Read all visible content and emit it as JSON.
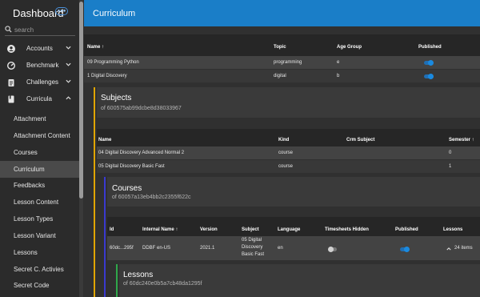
{
  "sidebar": {
    "title": "Dashboard",
    "badge": "●●●",
    "search_placeholder": "search",
    "sections": [
      {
        "label": "Accounts",
        "icon": "account-circle-icon"
      },
      {
        "label": "Benchmark",
        "icon": "speedometer-icon"
      },
      {
        "label": "Challenges",
        "icon": "clipboard-icon"
      },
      {
        "label": "Curricula",
        "icon": "book-icon"
      }
    ],
    "sub_items": [
      "Attachment",
      "Attachment Content",
      "Courses",
      "Curriculum",
      "Feedbacks",
      "Lesson Content",
      "Lesson Types",
      "Lesson Variant",
      "Lessons",
      "Secret C. Activies",
      "Secret Code"
    ],
    "active_item": "Curriculum"
  },
  "header": {
    "title": "Curriculum"
  },
  "curriculum_table": {
    "columns": [
      "Name ↑",
      "Topic",
      "Age Group",
      "Published"
    ],
    "rows": [
      {
        "name": "09 Programming Python",
        "topic": "programming",
        "age_group": "e",
        "published": true
      },
      {
        "name": "1 Digital Discovery",
        "topic": "digital",
        "age_group": "b",
        "published": true
      }
    ]
  },
  "subjects": {
    "title": "Subjects",
    "subtitle": "of 600575ab99dcbe8d38033967",
    "columns": [
      "Name",
      "Kind",
      "Crm Subject",
      "Semester ↑"
    ],
    "rows": [
      {
        "name": "04 Digital Discovery Advanced Normal 2",
        "kind": "course",
        "crm_subject": "",
        "semester": "0"
      },
      {
        "name": "05 Digital Discovery Basic Fast",
        "kind": "course",
        "crm_subject": "",
        "semester": "1"
      }
    ]
  },
  "courses": {
    "title": "Courses",
    "subtitle": "of 60057a13eb4bb2c2355f622c",
    "columns": [
      "Id",
      "Internal Name ↑",
      "Version",
      "Subject",
      "Language",
      "Timesheets Hidden",
      "Published",
      "Lessons"
    ],
    "row": {
      "id": "60dc...295f",
      "internal_name": "DDBF en-US",
      "version": "2021.1",
      "subject": [
        "05 Digital",
        "Discovery",
        "Basic Fast"
      ],
      "language": "en",
      "timesheets_hidden": false,
      "published": true,
      "lessons": "24 items"
    }
  },
  "lessons": {
    "title": "Lessons",
    "subtitle": "of 60dc240e0b5a7cb48da1295f"
  },
  "colors": {
    "header": "#1a7ec8",
    "subjects_bar": "#e0a500",
    "courses_bar": "#3a3ad0",
    "lessons_bar": "#2fa84a"
  }
}
